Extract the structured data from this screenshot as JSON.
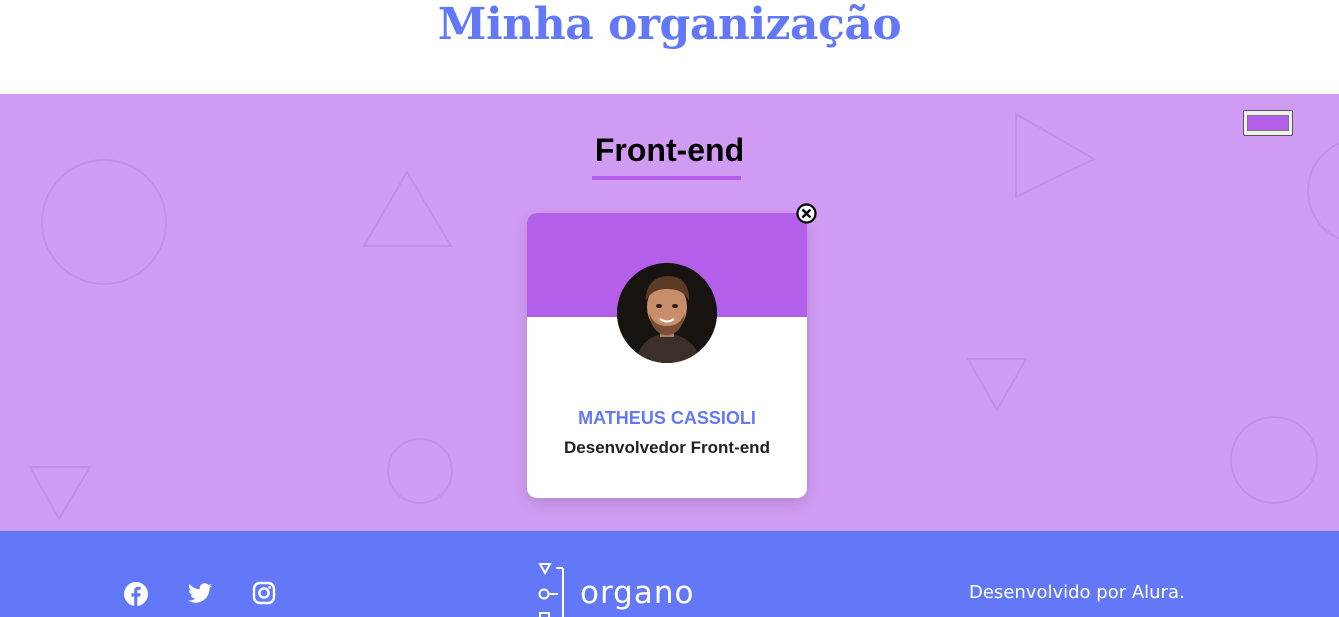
{
  "header": {
    "title": "Minha organização"
  },
  "team": {
    "name": "Front-end",
    "color": "#B45FEA",
    "background": "#D09CF3"
  },
  "members": [
    {
      "name": "MATHEUS CASSIOLI",
      "role": "Desenvolvedor Front-end"
    }
  ],
  "icons": {
    "delete": "close-circle-icon",
    "facebook": "facebook-icon",
    "twitter": "twitter-icon",
    "instagram": "instagram-icon"
  },
  "footer": {
    "logo_text": "organo",
    "credit": "Desenvolvido por Alura.",
    "background": "#6278F7"
  }
}
